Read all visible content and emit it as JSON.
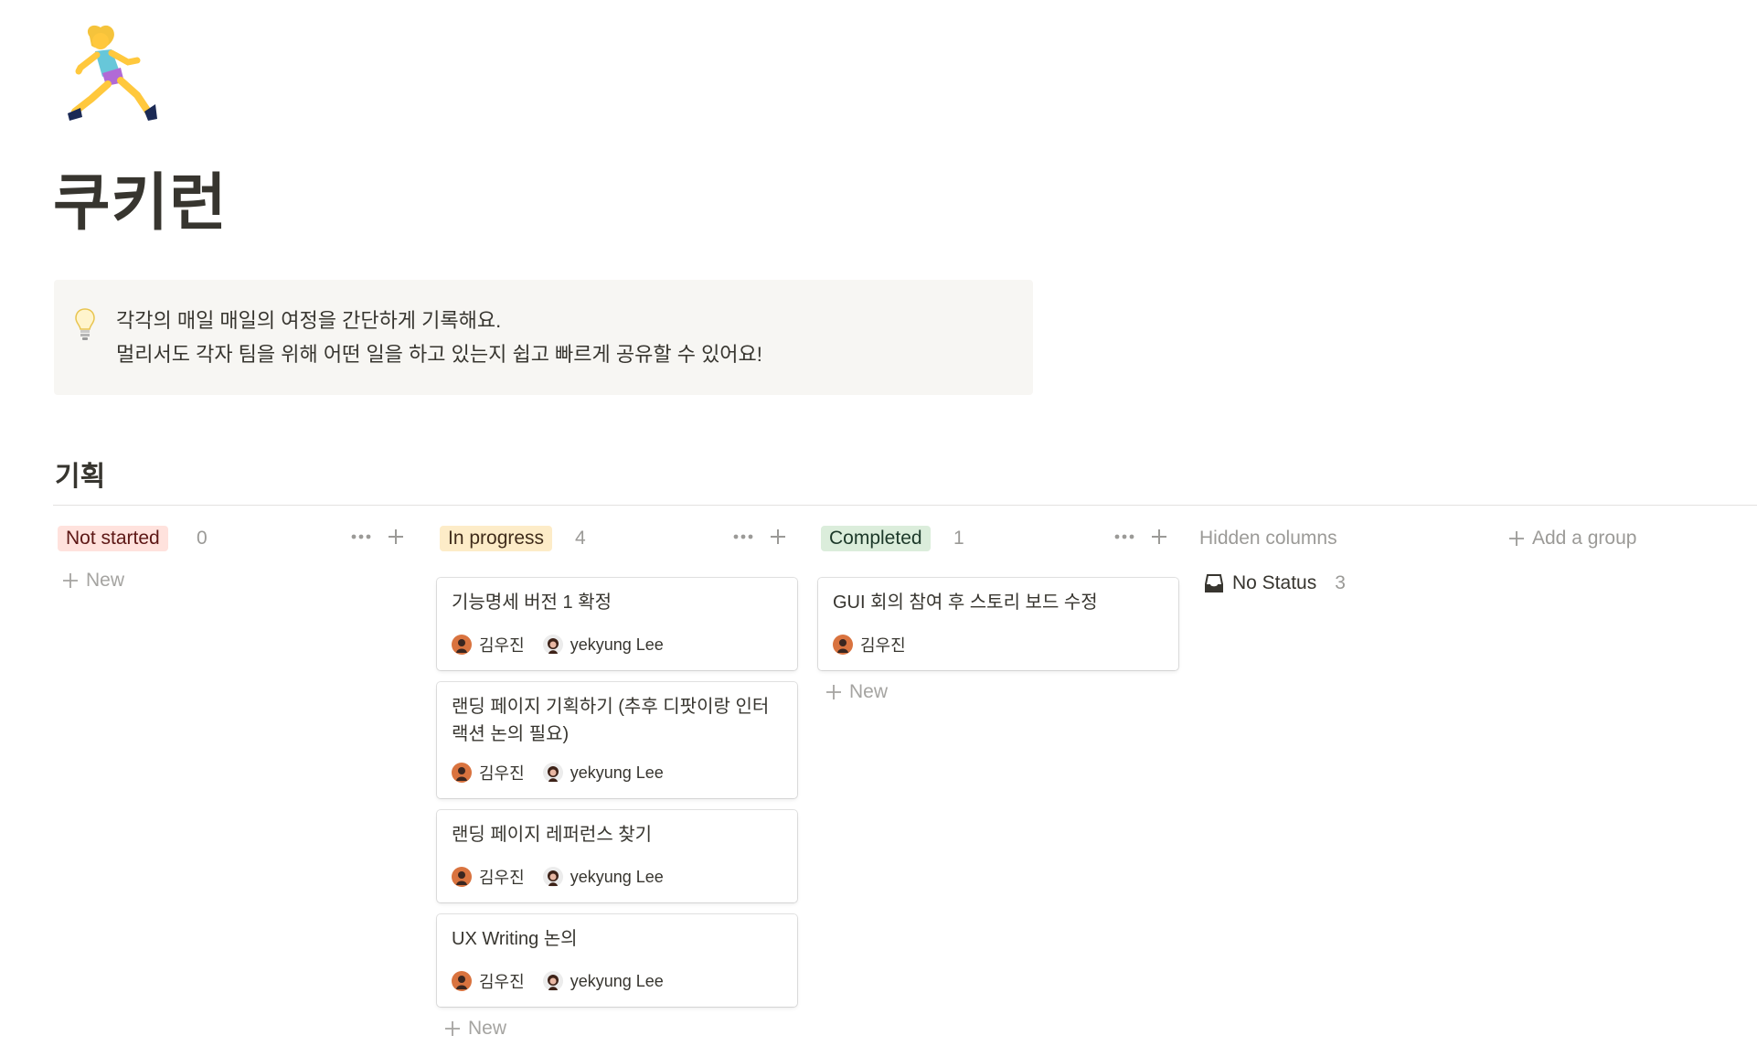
{
  "page": {
    "icon": "woman-running-emoji",
    "title": "쿠키런"
  },
  "callout": {
    "icon": "lightbulb-icon",
    "lines": [
      "각각의 매일 매일의 여정을 간단하게 기록해요.",
      "멀리서도 각자 팀을 위해 어떤 일을 하고 있는지 쉽고 빠르게 공유할 수 있어요!"
    ]
  },
  "board": {
    "title": "기획",
    "columns": [
      {
        "label": "Not started",
        "count": "0",
        "pill_bg": "#ffe2dd",
        "pill_color": "#5d1715",
        "cards": [],
        "new_label": "New"
      },
      {
        "label": "In progress",
        "count": "4",
        "pill_bg": "#fdecc8",
        "pill_color": "#402c1b",
        "cards": [
          {
            "title": "기능명세 버전 1 확정",
            "people": [
              "김우진",
              "yekyung Lee"
            ]
          },
          {
            "title": "랜딩 페이지 기획하기 (추후 디팟이랑 인터랙션 논의 필요)",
            "people": [
              "김우진",
              "yekyung Lee"
            ]
          },
          {
            "title": "랜딩 페이지 레퍼런스 찾기",
            "people": [
              "김우진",
              "yekyung Lee"
            ]
          },
          {
            "title": "UX Writing 논의",
            "people": [
              "김우진",
              "yekyung Lee"
            ]
          }
        ],
        "new_label": "New"
      },
      {
        "label": "Completed",
        "count": "1",
        "pill_bg": "#dbeddb",
        "pill_color": "#1c3829",
        "cards": [
          {
            "title": "GUI 회의 참여 후 스토리 보드 수정",
            "people": [
              "김우진"
            ]
          }
        ],
        "new_label": "New"
      }
    ],
    "hidden_columns": {
      "title": "Hidden columns",
      "items": [
        {
          "label": "No Status",
          "count": "3",
          "icon": "inbox-icon"
        }
      ]
    },
    "add_group_label": "Add a group"
  }
}
